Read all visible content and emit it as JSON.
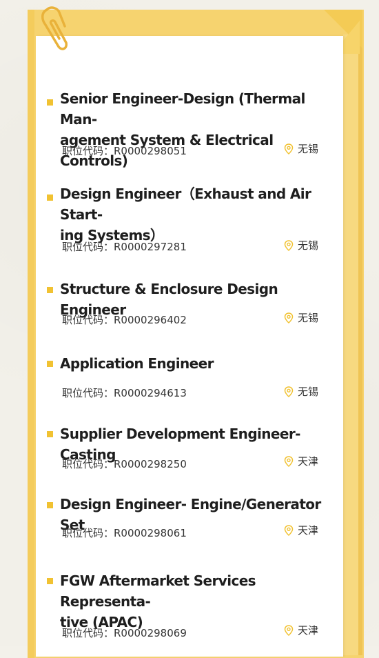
{
  "accent_color": "#f1c232",
  "frame_color": "#f6d36f",
  "code_label": "职位代码：",
  "jobs": [
    {
      "title": "Senior Engineer-Design (Thermal Man-agement System & Electrical Controls)",
      "title_lines": [
        "Senior Engineer-Design (Thermal Man-",
        "agement System & Electrical Controls)"
      ],
      "code": "职位代码：R0000298051",
      "location": "无锡"
    },
    {
      "title": "Design Engineer（Exhaust and Air Start-ing Systems）",
      "title_lines": [
        "Design Engineer（Exhaust and Air Start-",
        "ing Systems）"
      ],
      "code": "职位代码：R0000297281",
      "location": "无锡"
    },
    {
      "title": "Structure & Enclosure Design Engineer",
      "title_lines": [
        "Structure & Enclosure Design Engineer"
      ],
      "code": "职位代码：R0000296402",
      "location": "无锡"
    },
    {
      "title": "Application Engineer",
      "title_lines": [
        "Application Engineer"
      ],
      "code": "职位代码：R0000294613",
      "location": "无锡"
    },
    {
      "title": "Supplier Development Engineer-Casting",
      "title_lines": [
        "Supplier Development Engineer-Casting"
      ],
      "code": "职位代码：R0000298250",
      "location": "天津"
    },
    {
      "title": "Design Engineer- Engine/Generator Set",
      "title_lines": [
        "Design Engineer- Engine/Generator Set"
      ],
      "code": "职位代码：R0000298061",
      "location": "天津"
    },
    {
      "title": "FGW Aftermarket Services Representa-tive (APAC)",
      "title_lines": [
        "FGW Aftermarket Services Representa-",
        "tive (APAC)"
      ],
      "code": "职位代码：R0000298069",
      "location": "天津"
    }
  ]
}
